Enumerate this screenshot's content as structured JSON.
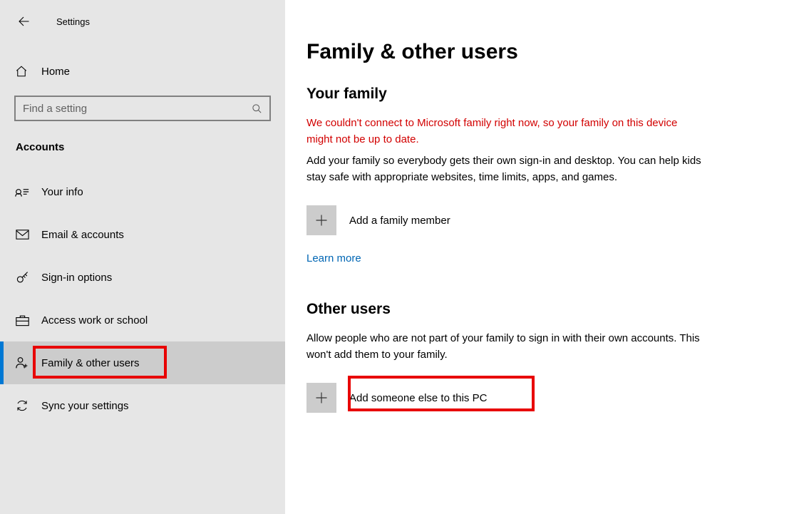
{
  "topbar": {
    "title": "Settings"
  },
  "home_label": "Home",
  "search": {
    "placeholder": "Find a setting"
  },
  "sidebar": {
    "section": "Accounts",
    "items": [
      {
        "label": "Your info"
      },
      {
        "label": "Email & accounts"
      },
      {
        "label": "Sign-in options"
      },
      {
        "label": "Access work or school"
      },
      {
        "label": "Family & other users"
      },
      {
        "label": "Sync your settings"
      }
    ]
  },
  "main": {
    "title": "Family & other users",
    "family": {
      "heading": "Your family",
      "error": "We couldn't connect to Microsoft family right now, so your family on this device might not be up to date.",
      "description": "Add your family so everybody gets their own sign-in and desktop. You can help kids stay safe with appropriate websites, time limits, apps, and games.",
      "add_label": "Add a family member",
      "learn_more": "Learn more"
    },
    "other": {
      "heading": "Other users",
      "description": "Allow people who are not part of your family to sign in with their own accounts. This won't add them to your family.",
      "add_label": "Add someone else to this PC"
    }
  }
}
